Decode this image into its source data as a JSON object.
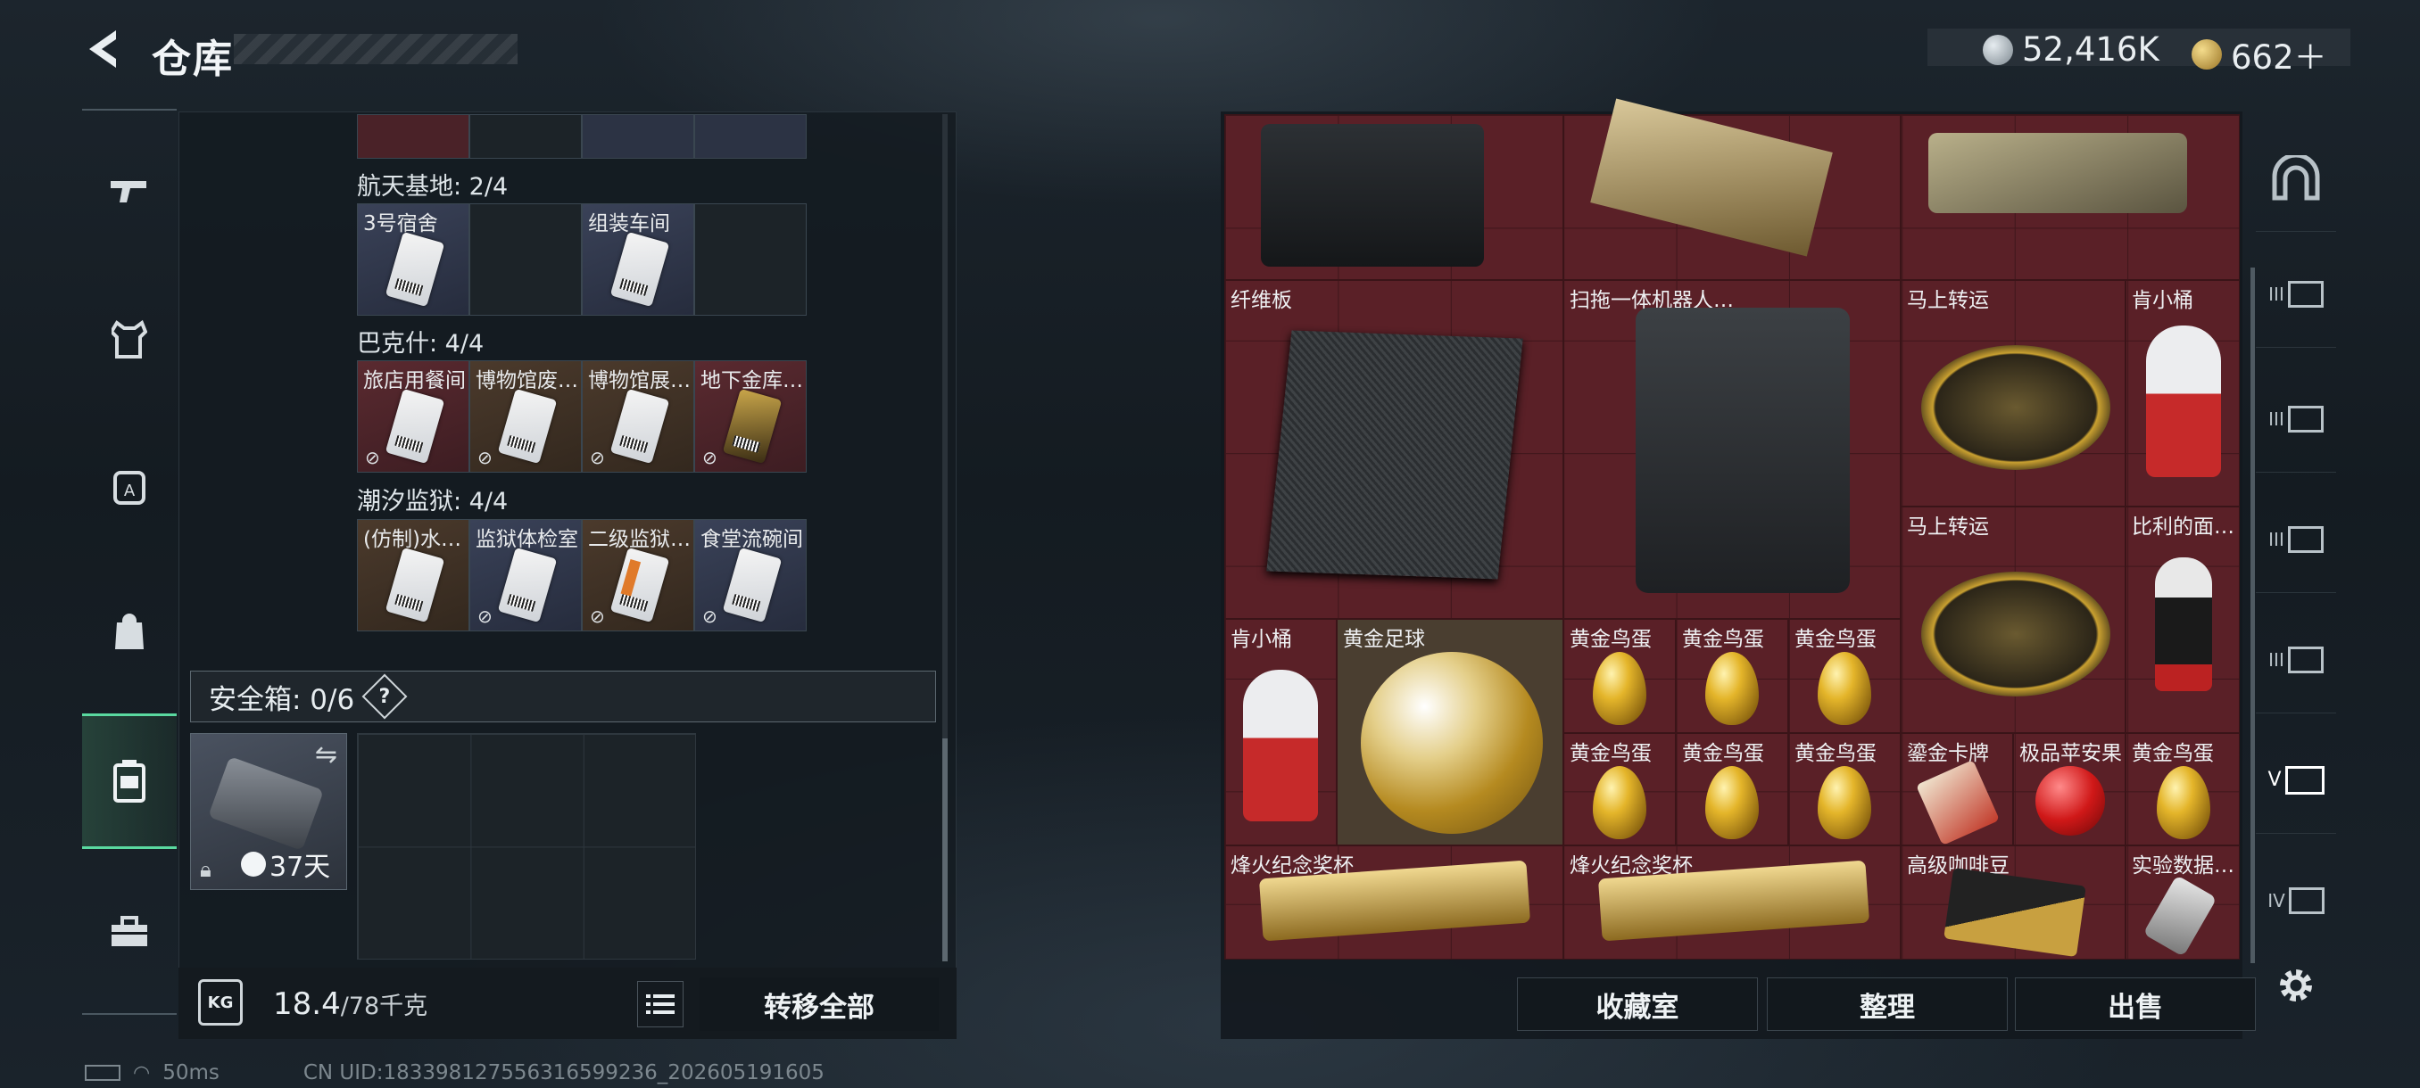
{
  "header": {
    "title": "仓库",
    "currency": [
      {
        "icon": "silver-coin-icon",
        "value": "52,416K",
        "color": "#b9c4cc"
      },
      {
        "icon": "gold-coin-icon",
        "value": "662＋",
        "color": "#d9b35a"
      }
    ]
  },
  "left_nav": [
    {
      "icon": "rifle-icon"
    },
    {
      "icon": "vest-icon"
    },
    {
      "icon": "backpack-armor-icon"
    },
    {
      "icon": "backpack-icon"
    },
    {
      "icon": "keycard-case-icon",
      "active": true
    },
    {
      "icon": "toolbox-icon"
    }
  ],
  "sections": [
    {
      "title": "航天基地: 2/4",
      "items": [
        {
          "label": "3号宿舍",
          "color": "blue"
        },
        {
          "label": "",
          "color": "empty"
        },
        {
          "label": "组装车间",
          "color": "blue"
        },
        {
          "label": "",
          "color": "empty"
        }
      ]
    },
    {
      "title": "巴克什: 4/4",
      "items": [
        {
          "label": "旅店用餐间",
          "color": "red"
        },
        {
          "label": "博物馆废…",
          "color": "brown"
        },
        {
          "label": "博物馆展…",
          "color": "brown"
        },
        {
          "label": "地下金库…",
          "color": "red"
        }
      ]
    },
    {
      "title": "潮汐监狱: 4/4",
      "items": [
        {
          "label": "(仿制)水…",
          "color": "brown"
        },
        {
          "label": "监狱体检室",
          "color": "blue"
        },
        {
          "label": "二级监狱…",
          "color": "brown"
        },
        {
          "label": "食堂流碗间",
          "color": "blue"
        }
      ]
    }
  ],
  "safe_box": {
    "label": "安全箱: 0/6",
    "help": "?",
    "time": "37天"
  },
  "weight": {
    "current": "18.4",
    "max": "/78千克"
  },
  "transfer_all": "转移全部",
  "grid_items": [
    {
      "label": "纤维板"
    },
    {
      "label": "扫拖一体机器人…"
    },
    {
      "label": "马上转运"
    },
    {
      "label": "肯小桶"
    },
    {
      "label": "马上转运"
    },
    {
      "label": "比利的面…"
    },
    {
      "label": "肯小桶"
    },
    {
      "label": "黄金足球"
    },
    {
      "label": "黄金鸟蛋"
    },
    {
      "label": "黄金鸟蛋"
    },
    {
      "label": "黄金鸟蛋"
    },
    {
      "label": "黄金鸟蛋"
    },
    {
      "label": "黄金鸟蛋"
    },
    {
      "label": "黄金鸟蛋"
    },
    {
      "label": "鎏金卡牌"
    },
    {
      "label": "极品苹安果"
    },
    {
      "label": "黄金鸟蛋"
    },
    {
      "label": "烽火纪念奖杯"
    },
    {
      "label": "烽火纪念奖杯"
    },
    {
      "label": "高级咖啡豆"
    },
    {
      "label": "实验数据…"
    }
  ],
  "bottom_buttons": {
    "collection": "收藏室",
    "sort": "整理",
    "sell": "出售"
  },
  "right_nav": [
    {
      "icon": "safe-arch-icon"
    },
    {
      "icon": "storage-III-icon",
      "tag": "III"
    },
    {
      "icon": "storage-III-icon",
      "tag": "III"
    },
    {
      "icon": "storage-III-icon",
      "tag": "III"
    },
    {
      "icon": "storage-III-icon",
      "tag": "III"
    },
    {
      "icon": "storage-V-icon",
      "tag": "V"
    },
    {
      "icon": "storage-IV-icon",
      "tag": "IV"
    }
  ],
  "status": {
    "ping": "50ms",
    "uid": "CN UID:183398127556316599236_202605191605"
  }
}
